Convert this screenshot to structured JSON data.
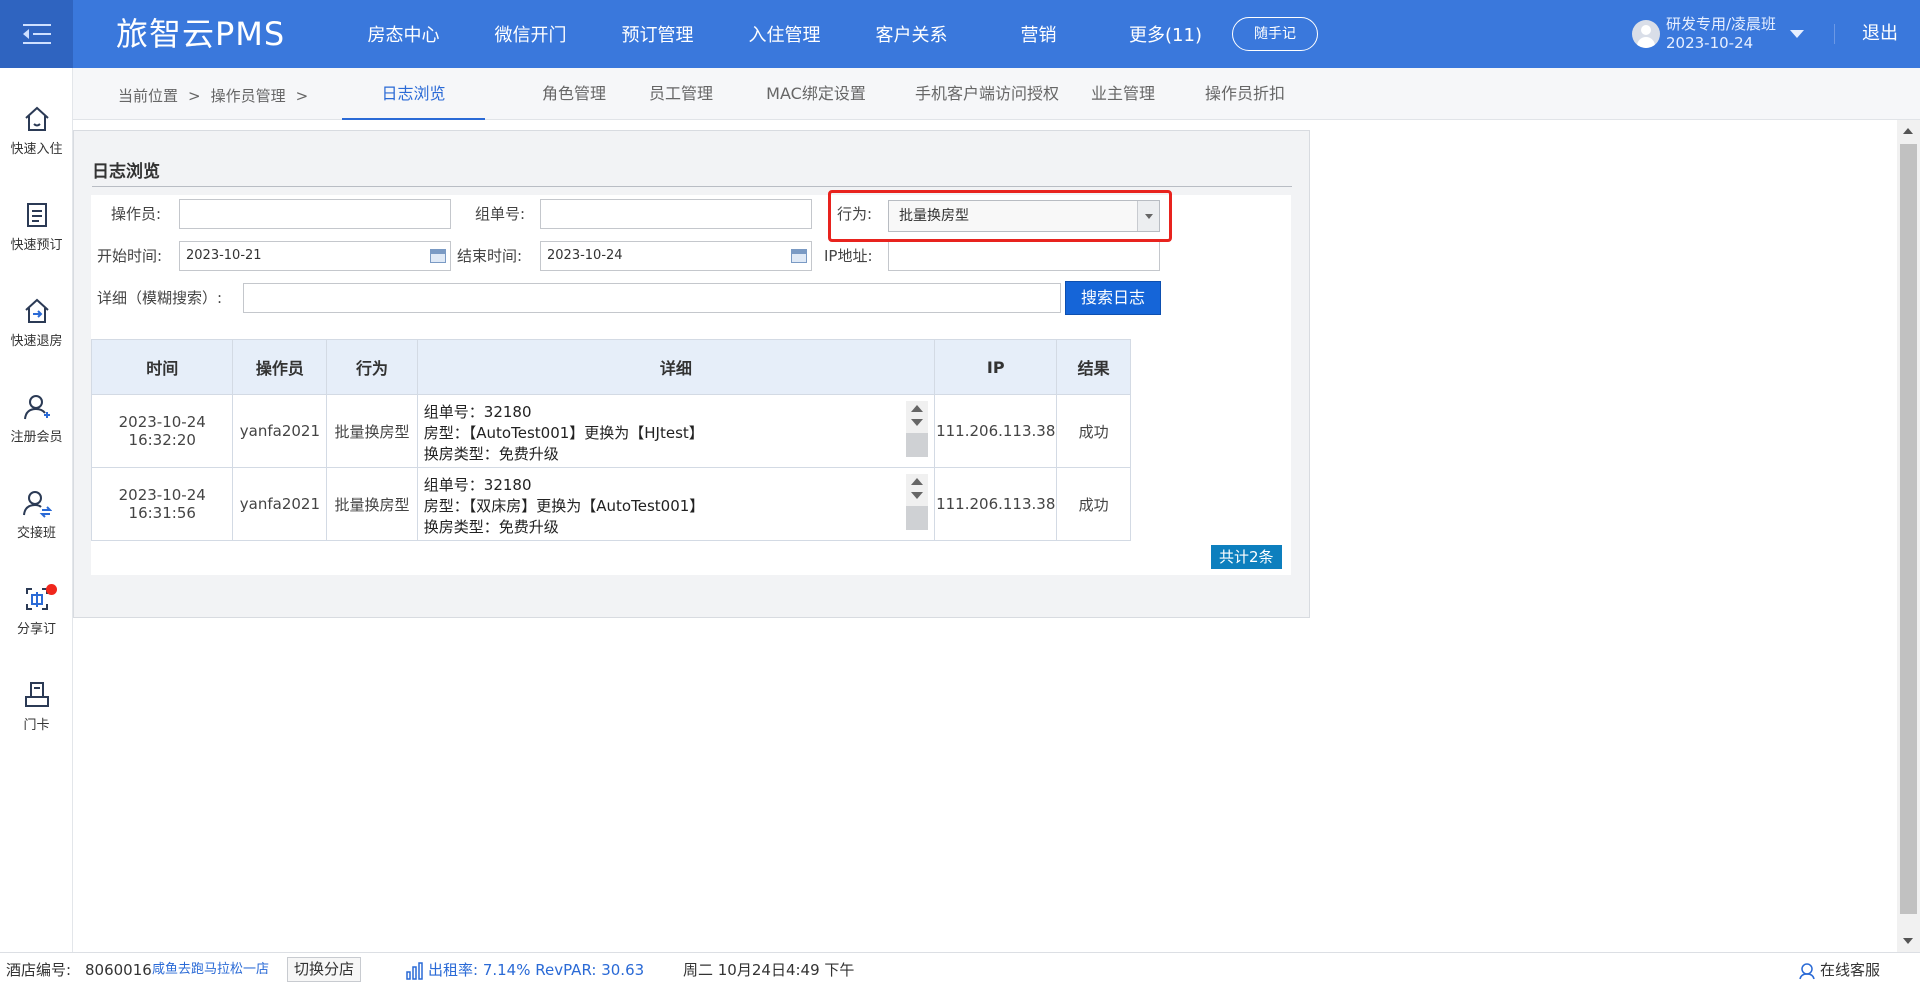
{
  "header": {
    "logo": "旅智云PMS",
    "nav": [
      "房态中心",
      "微信开门",
      "预订管理",
      "入住管理",
      "客户关系",
      "营销",
      "更多(11)"
    ],
    "memo_button": "随手记",
    "user_name": "研发专用/凌晨班",
    "user_date": "2023-10-24",
    "logout": "退出"
  },
  "sidebar": {
    "items": [
      {
        "label": "快速入住",
        "icon": "home-icon"
      },
      {
        "label": "快速预订",
        "icon": "document-icon"
      },
      {
        "label": "快速退房",
        "icon": "checkout-icon"
      },
      {
        "label": "注册会员",
        "icon": "add-user-icon"
      },
      {
        "label": "交接班",
        "icon": "shift-handover-icon"
      },
      {
        "label": "分享订",
        "icon": "share-order-icon"
      },
      {
        "label": "门卡",
        "icon": "door-card-icon"
      }
    ]
  },
  "breadcrumb": {
    "current_label": "当前位置",
    "sep": ">",
    "section": "操作员管理",
    "sep2": ">"
  },
  "tabs": [
    "日志浏览",
    "角色管理",
    "员工管理",
    "MAC绑定设置",
    "手机客户端访问授权",
    "业主管理",
    "操作员折扣"
  ],
  "panel": {
    "title": "日志浏览",
    "operator_label": "操作员:",
    "operator_value": "",
    "group_no_label": "组单号:",
    "group_no_value": "",
    "action_label": "行为:",
    "action_value": "批量换房型",
    "start_label": "开始时间:",
    "start_value": "2023-10-21",
    "end_label": "结束时间:",
    "end_value": "2023-10-24",
    "ip_label": "IP地址:",
    "ip_value": "",
    "detail_label": "详细（模糊搜索）:",
    "detail_value": "",
    "search_button": "搜索日志",
    "total": "共计2条"
  },
  "table": {
    "headers": [
      "时间",
      "操作员",
      "行为",
      "详细",
      "IP",
      "结果"
    ],
    "rows": [
      {
        "date": "2023-10-24",
        "time": "16:32:20",
        "operator": "yanfa2021",
        "action": "批量换房型",
        "detail_line1": "组单号：32180",
        "detail_line2": "房型：【AutoTest001】更换为【HJtest】",
        "detail_line3": "换房类型：免费升级",
        "ip": "111.206.113.38",
        "result": "成功"
      },
      {
        "date": "2023-10-24",
        "time": "16:31:56",
        "operator": "yanfa2021",
        "action": "批量换房型",
        "detail_line1": "组单号：32180",
        "detail_line2": "房型：【双床房】更换为【AutoTest001】",
        "detail_line3": "换房类型：免费升级",
        "ip": "111.206.113.38",
        "result": "成功"
      }
    ]
  },
  "statusbar": {
    "hotel_no_label": "酒店编号:",
    "hotel_no": "8060016",
    "hotel_name": "咸鱼去跑马拉松一店",
    "switch_branch": "切换分店",
    "occupancy": "出租率: 7.14% RevPAR: 30.63",
    "datetime": "周二 10月24日4:49 下午",
    "online_service": "在线客服"
  },
  "colors": {
    "header_bg": "#3a78dc",
    "accent": "#2a6ad6",
    "highlight_box": "#e8231e",
    "total_badge": "#0d7fbe"
  }
}
